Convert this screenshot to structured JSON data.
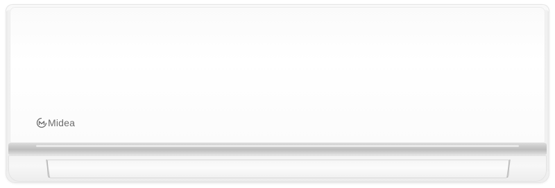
{
  "product": {
    "brand": "Midea",
    "logo_icon": "midea-swoosh-icon"
  },
  "colors": {
    "body": "#f9f9f9",
    "accent_strip": "#c9c9c9",
    "logo": "#6d6d6d"
  }
}
